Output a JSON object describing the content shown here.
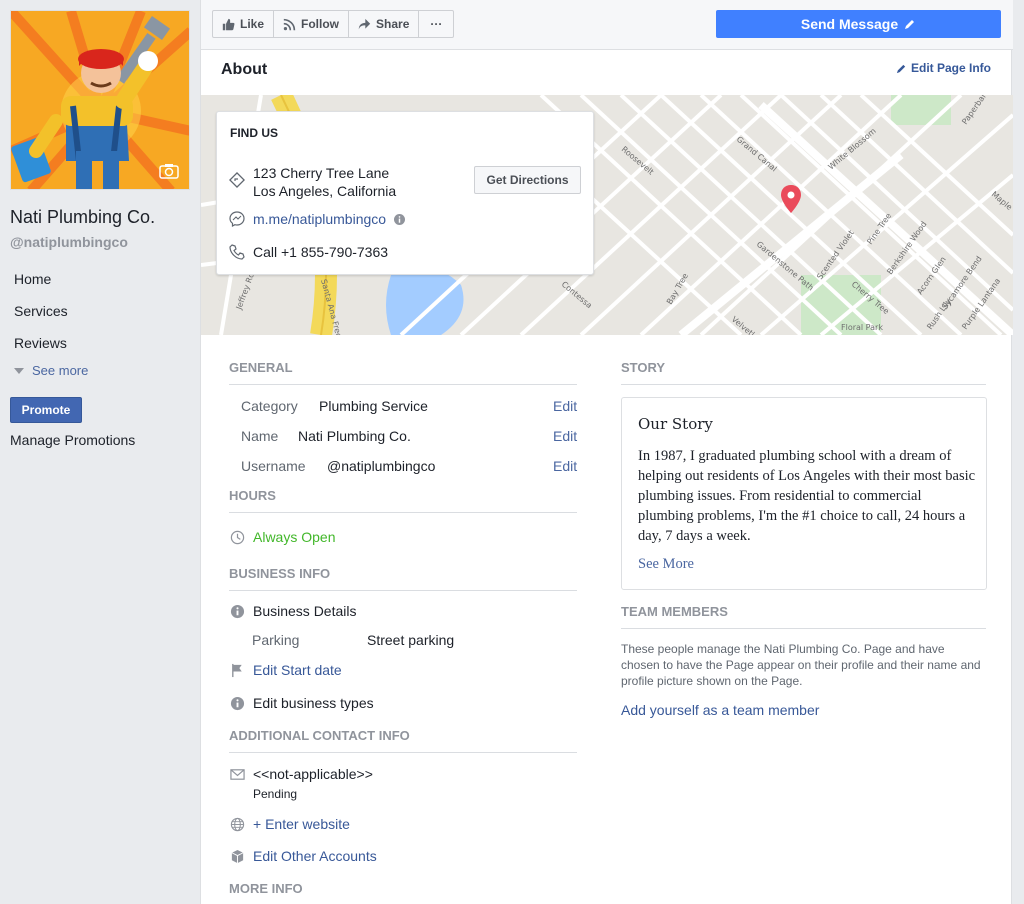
{
  "sidebar": {
    "page_name": "Nati Plumbing Co.",
    "page_handle": "@natiplumbingco",
    "nav": [
      {
        "label": "Home"
      },
      {
        "label": "Services"
      },
      {
        "label": "Reviews"
      }
    ],
    "see_more": "See more",
    "promote": "Promote",
    "manage_promotions": "Manage Promotions"
  },
  "actionbar": {
    "like": "Like",
    "follow": "Follow",
    "share": "Share",
    "more": "···",
    "send_message": "Send Message"
  },
  "about": {
    "title": "About",
    "edit_page_info": "Edit Page Info"
  },
  "find_us": {
    "title": "FIND US",
    "address_line1": "123 Cherry Tree Lane",
    "address_line2": "Los Angeles, California",
    "get_directions": "Get Directions",
    "messenger": "m.me/natiplumbingco",
    "phone": "Call +1 855-790-7363"
  },
  "map": {
    "labels": [
      "Grand Canal",
      "Roosevelt",
      "White Blossom",
      "Gardenstone Path",
      "Scented Violet",
      "Pine Tree",
      "Berkshire Wood",
      "Acorn Glen",
      "Sycamore Bend",
      "Cherry Tree",
      "Bay Tree",
      "Velvetleaf",
      "Contessa",
      "Floral Park",
      "Paperbark",
      "Jeffrey Rd",
      "Santa Ana Freeway",
      "Purple Lantana",
      "Rush Lily",
      "Maple"
    ]
  },
  "general": {
    "heading": "GENERAL",
    "rows": [
      {
        "label": "Category",
        "value": "Plumbing Service",
        "edit": "Edit"
      },
      {
        "label": "Name",
        "value": "Nati Plumbing Co.",
        "edit": "Edit"
      },
      {
        "label": "Username",
        "value": "@natiplumbingco",
        "edit": "Edit"
      }
    ]
  },
  "hours": {
    "heading": "HOURS",
    "value": "Always Open",
    "value_color": "#42b72a"
  },
  "business_info": {
    "heading": "BUSINESS INFO",
    "details": "Business Details",
    "parking_label": "Parking",
    "parking_value": "Street parking",
    "edit_start_date": "Edit Start date",
    "edit_business_types": "Edit business types"
  },
  "contact": {
    "heading": "ADDITIONAL CONTACT INFO",
    "email": "<<not-applicable>>",
    "email_status": "Pending",
    "website": "+ Enter website",
    "other_accounts": "Edit Other Accounts"
  },
  "more_info": {
    "heading": "MORE INFO"
  },
  "story": {
    "heading": "STORY",
    "title": "Our Story",
    "text": "In 1987, I graduated plumbing school with a dream of helping out residents of Los Angeles with their most basic plumbing issues. From residential to commercial plumbing problems, I'm the #1 choice to call, 24 hours a day, 7 days a week.",
    "see_more": "See More"
  },
  "team": {
    "heading": "TEAM MEMBERS",
    "description": "These people manage the Nati Plumbing Co. Page and have chosen to have the Page appear on their profile and their name and profile picture shown on the Page.",
    "add_link": "Add yourself as a team member"
  },
  "colors": {
    "accent": "#4080ff",
    "link": "#385898",
    "promote": "#4267b2"
  }
}
